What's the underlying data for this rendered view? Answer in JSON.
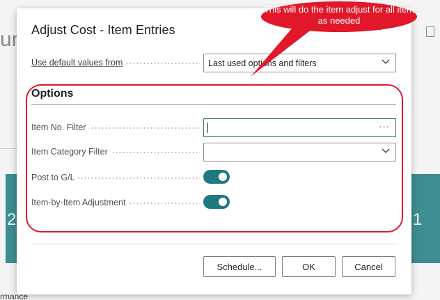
{
  "dialog": {
    "title": "Adjust Cost - Item Entries"
  },
  "default_values": {
    "label": "Use default values from",
    "value": "Last used options and filters"
  },
  "options": {
    "title": "Options",
    "item_no_filter": {
      "label": "Item No. Filter",
      "value": "",
      "ellipsis": "···"
    },
    "item_category_filter": {
      "label": "Item Category Filter",
      "value": ""
    },
    "post_to_gl": {
      "label": "Post to G/L",
      "on": true
    },
    "item_by_item": {
      "label": "Item-by-Item Adjustment",
      "on": true
    }
  },
  "buttons": {
    "schedule": "Schedule...",
    "ok": "OK",
    "cancel": "Cancel"
  },
  "annotation": {
    "callout": "This will do the item adjust for all item as needed",
    "color": "#e2182a"
  },
  "background": {
    "left_text": "un",
    "teal_left_char": "2",
    "teal_right_char": "1",
    "footer_text": "rmance"
  },
  "colors": {
    "accent": "#1f7a80",
    "teal_tile": "#3e8d92"
  }
}
